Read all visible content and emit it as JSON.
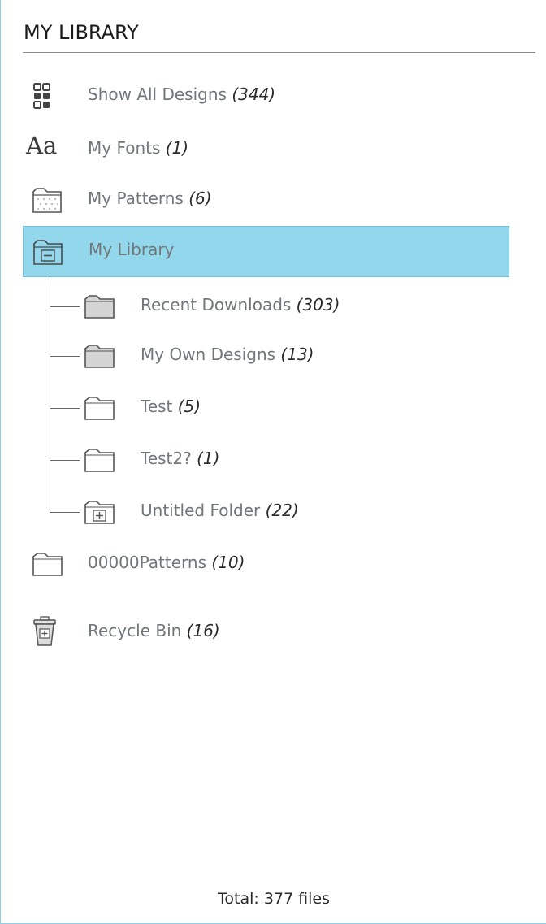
{
  "panel": {
    "title": "MY LIBRARY"
  },
  "items": [
    {
      "label": "Show All Designs",
      "count": "(344)",
      "icon": "grid-icon"
    },
    {
      "label": "My Fonts",
      "count": "(1)",
      "icon": "font-icon",
      "icon_text": "Aa"
    },
    {
      "label": "My Patterns",
      "count": "(6)",
      "icon": "pattern-folder-icon"
    },
    {
      "label": "My Library",
      "count": "",
      "icon": "folder-collapse-icon",
      "selected": true
    },
    {
      "label": "Recent Downloads",
      "count": "(303)",
      "icon": "folder-filled-icon"
    },
    {
      "label": "My Own Designs",
      "count": "(13)",
      "icon": "folder-filled-icon"
    },
    {
      "label": "Test",
      "count": "(5)",
      "icon": "folder-icon"
    },
    {
      "label": "Test2?",
      "count": "(1)",
      "icon": "folder-icon"
    },
    {
      "label": "Untitled Folder",
      "count": "(22)",
      "icon": "folder-expand-icon"
    },
    {
      "label": "00000Patterns",
      "count": "(10)",
      "icon": "folder-icon"
    },
    {
      "label": "Recycle Bin",
      "count": "(16)",
      "icon": "recycle-bin-icon"
    }
  ],
  "footer": {
    "total": "Total: 377 files"
  },
  "colors": {
    "selection": "#92d7ec",
    "label": "#717779",
    "count": "#2a2a2a"
  }
}
